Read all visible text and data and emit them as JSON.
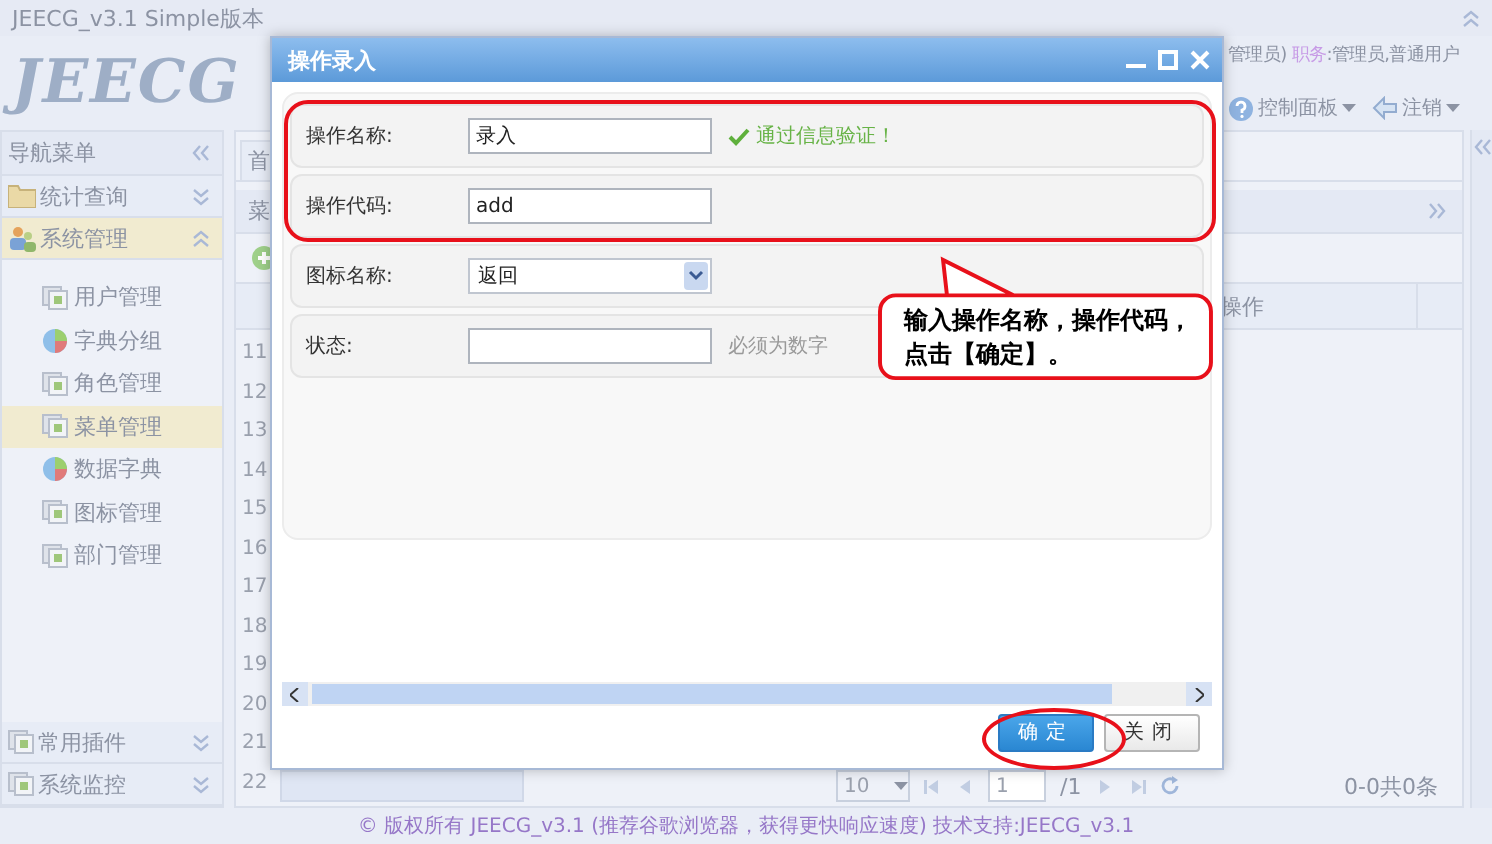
{
  "app_title": "JEECG_v3.1 Simple版本",
  "header": {
    "logo": "JEECG",
    "user_info": "管理员)",
    "role_label": "职务",
    "role_value": ":管理员,普通用户",
    "menus": [
      {
        "label": "控制面板",
        "kind": "help"
      },
      {
        "label": "注销",
        "kind": "logout"
      }
    ]
  },
  "sidebar": {
    "title": "导航菜单",
    "groups": [
      {
        "label": "统计查询",
        "kind": "folder",
        "expanded": false,
        "selected": false
      },
      {
        "label": "系统管理",
        "kind": "users",
        "expanded": true,
        "selected": true,
        "children": [
          {
            "label": "用户管理",
            "kind": "page",
            "selected": false
          },
          {
            "label": "字典分组",
            "kind": "pie",
            "selected": false
          },
          {
            "label": "角色管理",
            "kind": "page",
            "selected": false
          },
          {
            "label": "菜单管理",
            "kind": "page",
            "selected": true
          },
          {
            "label": "数据字典",
            "kind": "pie",
            "selected": false
          },
          {
            "label": "图标管理",
            "kind": "page",
            "selected": false
          },
          {
            "label": "部门管理",
            "kind": "page",
            "selected": false
          }
        ]
      },
      {
        "label": "常用插件",
        "kind": "page",
        "expanded": false,
        "selected": false
      },
      {
        "label": "系统监控",
        "kind": "page",
        "expanded": false,
        "selected": false
      }
    ]
  },
  "main": {
    "tab": "首",
    "panel_title": "菜",
    "column": "操作",
    "row_numbers": [
      "11",
      "12",
      "13",
      "14",
      "15",
      "16",
      "17",
      "18",
      "19",
      "20",
      "21",
      "22"
    ],
    "pager": {
      "page_size": "10",
      "page": "1",
      "total_pages": "/1",
      "summary": "0-0共0条"
    }
  },
  "dialog": {
    "title": "操作录入",
    "fields": [
      {
        "label": "操作名称:",
        "kind": "input",
        "value": "录入",
        "validation": "通过信息验证！"
      },
      {
        "label": "操作代码:",
        "kind": "input",
        "value": "add"
      },
      {
        "label": "图标名称:",
        "kind": "select",
        "value": "返回"
      },
      {
        "label": "状态:",
        "kind": "input",
        "hint": "必须为数字"
      }
    ],
    "buttons": [
      {
        "label": "确定",
        "primary": true
      },
      {
        "label": "关闭",
        "primary": false
      }
    ]
  },
  "callout": "输入操作名称，操作代码，点击【确定】。",
  "footer": "© 版权所有 JEECG_v3.1 (推荐谷歌浏览器，获得更快响应速度) 技术支持:JEECG_v3.1"
}
